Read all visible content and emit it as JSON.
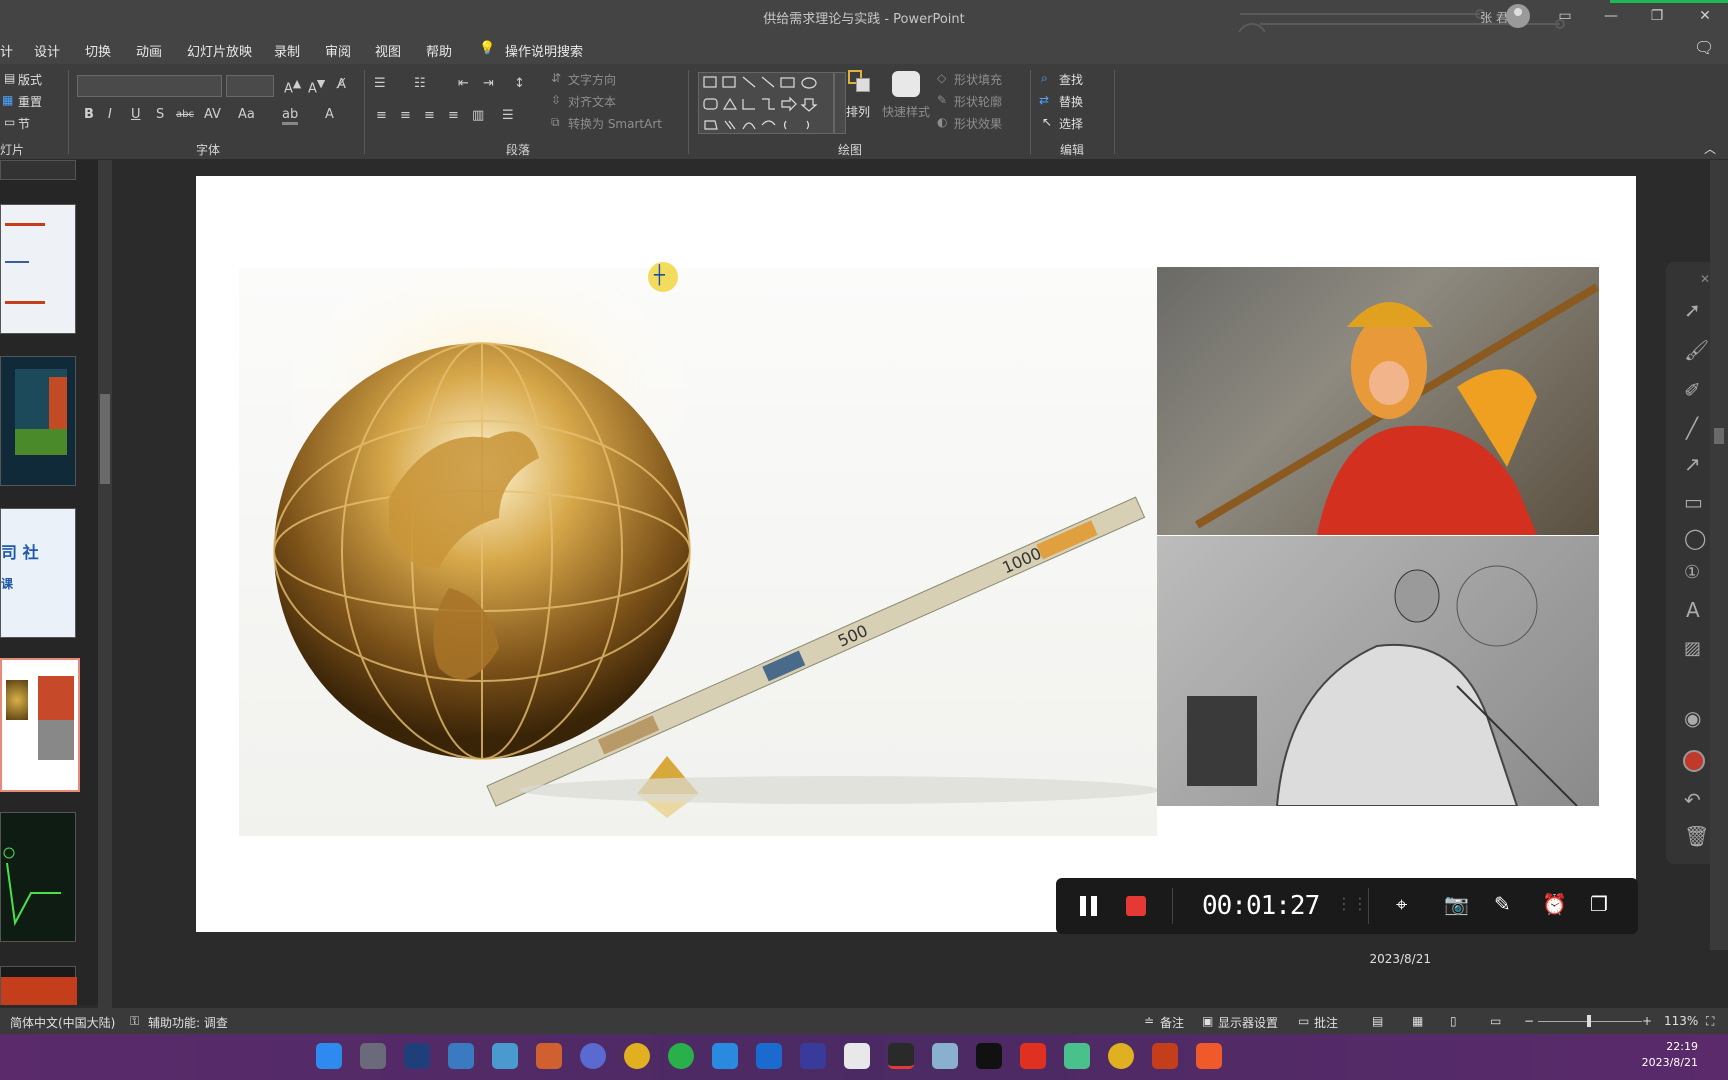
{
  "window": {
    "title": "供给需求理论与实践 - PowerPoint",
    "user": "张 君生"
  },
  "menu": {
    "tabs": [
      "设计",
      "切换",
      "动画",
      "幻灯片放映",
      "录制",
      "审阅",
      "视图",
      "帮助"
    ],
    "partial_tab": "计",
    "tell_me": "操作说明搜索"
  },
  "ribbon": {
    "slides_group": {
      "layout": "版式",
      "reset": "重置",
      "section": "节",
      "label": "灯片"
    },
    "font_group": {
      "label": "字体",
      "bold": "B",
      "italic": "I",
      "underline": "U",
      "shadow": "S",
      "strike": "abc",
      "aa": "Aa"
    },
    "paragraph_group": {
      "label": "段落",
      "text_direction": "文字方向",
      "align_text": "对齐文本",
      "smartart": "转换为 SmartArt"
    },
    "drawing_group": {
      "label": "绘图",
      "arrange": "排列",
      "quick_styles": "快速样式",
      "shape_fill": "形状填充",
      "shape_outline": "形状轮廓",
      "shape_effects": "形状效果"
    },
    "editing_group": {
      "label": "编辑",
      "find": "查找",
      "replace": "替换",
      "select": "选择"
    }
  },
  "slide": {
    "date": "2023/8/21",
    "images": [
      "golden-globe-on-money-seesaw",
      "monkey-king-photo",
      "thinking-philosopher-engraving"
    ],
    "banknote_labels": [
      "500",
      "1000"
    ]
  },
  "recorder": {
    "timer": "00:01:27"
  },
  "status": {
    "language": "简体中文(中国大陆)",
    "accessibility": "辅助功能: 调查",
    "notes": "备注",
    "display_settings": "显示器设置",
    "comments": "批注",
    "zoom_minus": "−",
    "zoom_plus": "+",
    "zoom": "113%"
  },
  "taskbar": {
    "time": "22:19",
    "date": "2023/8/21"
  },
  "colors": {
    "accent": "#c43e1c",
    "record_red": "#e53935",
    "taskbar": "#4b2a63"
  }
}
